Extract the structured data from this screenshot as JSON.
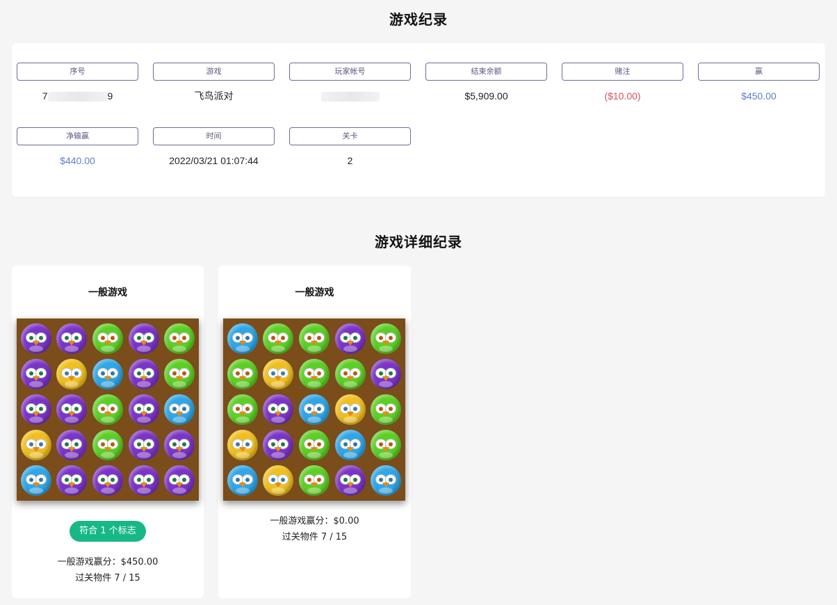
{
  "record_title": "游戏纪录",
  "detail_title": "游戏详细纪录",
  "fields": [
    {
      "label": "序号",
      "value_prefix": "7",
      "value_suffix": "9"
    },
    {
      "label": "游戏",
      "value": "飞鸟派对"
    },
    {
      "label": "玩家帐号",
      "value": ""
    },
    {
      "label": "结束余额",
      "value": "$5,909.00"
    },
    {
      "label": "赌注",
      "value": "($10.00)"
    },
    {
      "label": "赢",
      "value": "$450.00"
    },
    {
      "label": "净输赢",
      "value": "$440.00"
    },
    {
      "label": "时间",
      "value": "2022/03/21 01:07:44"
    },
    {
      "label": "关卡",
      "value": "2"
    }
  ],
  "cards": [
    {
      "title": "一般游戏",
      "badge": "符合 1 个标志",
      "win_line": "一般游戏赢分：$450.00",
      "progress_line": "过关物件 7 / 15",
      "board": [
        [
          "purple",
          "purple",
          "green",
          "purple",
          "green"
        ],
        [
          "purple",
          "yellow",
          "blue",
          "purple",
          "green"
        ],
        [
          "purple",
          "purple",
          "green",
          "purple",
          "blue"
        ],
        [
          "yellow",
          "purple",
          "green",
          "purple",
          "purple"
        ],
        [
          "blue",
          "purple",
          "purple",
          "purple",
          "purple"
        ]
      ]
    },
    {
      "title": "一般游戏",
      "win_line": "一般游戏赢分：$0.00",
      "progress_line": "过关物件 7 / 15",
      "board": [
        [
          "blue",
          "green",
          "green",
          "purple",
          "green"
        ],
        [
          "green",
          "yellow",
          "green",
          "green",
          "purple"
        ],
        [
          "green",
          "purple",
          "blue",
          "yellow",
          "green"
        ],
        [
          "yellow",
          "purple",
          "green",
          "blue",
          "green"
        ],
        [
          "blue",
          "yellow",
          "green",
          "purple",
          "blue"
        ]
      ]
    }
  ],
  "colors": {
    "accent_badge": "#17b886",
    "negative": "#d6505a",
    "positive": "#5b7fcf",
    "board_bg": "#7a4d1a"
  }
}
